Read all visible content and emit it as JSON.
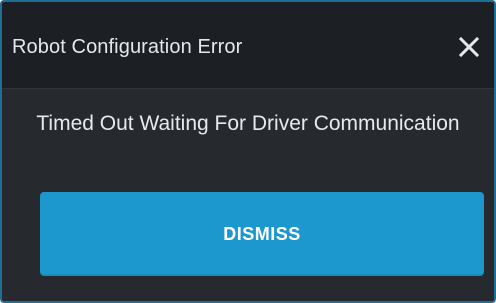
{
  "dialog": {
    "title": "Robot Configuration Error",
    "message": "Timed Out Waiting For Driver Communication",
    "dismiss_label": "DISMISS",
    "close_icon": "close-icon"
  },
  "colors": {
    "accent": "#1c98cf",
    "background": "#262a2e",
    "titlebar": "#1c1f23",
    "border": "#1f6f94"
  }
}
